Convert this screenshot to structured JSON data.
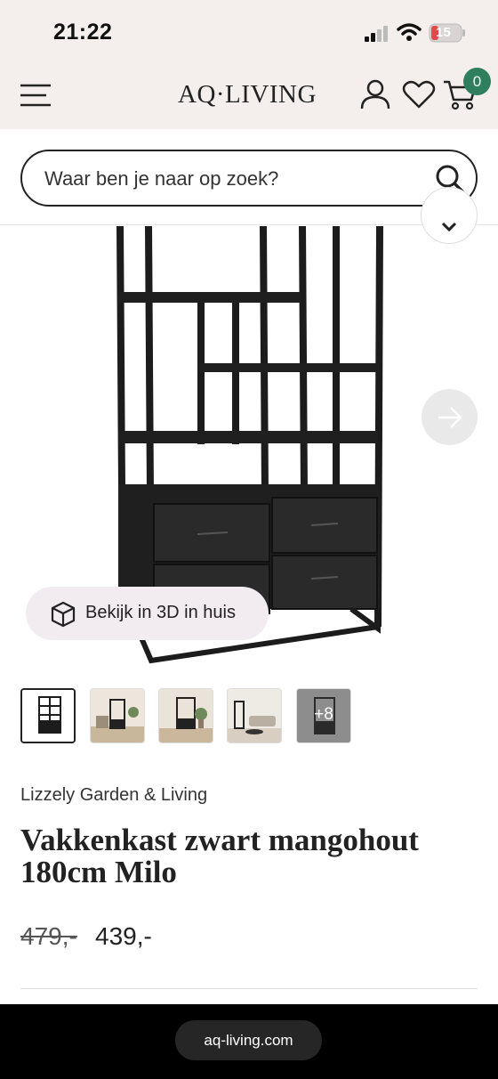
{
  "status_bar": {
    "time": "21:22",
    "battery": "15"
  },
  "header": {
    "logo": "AQ·LIVING",
    "cart_count": "0"
  },
  "search": {
    "placeholder": "Waar ben je naar op zoek?"
  },
  "gallery": {
    "view_3d_label": "Bekijk in 3D in huis",
    "more_count": "+8"
  },
  "product": {
    "brand": "Lizzely Garden & Living",
    "title": "Vakkenkast zwart mangohout 180cm Milo",
    "old_price": "479,-",
    "price": "439,-"
  },
  "browser": {
    "url": "aq-living.com"
  },
  "colors": {
    "header_bg": "#f4efec",
    "badge": "#2f7f5f",
    "view3d_bg": "#f2ecf0"
  }
}
